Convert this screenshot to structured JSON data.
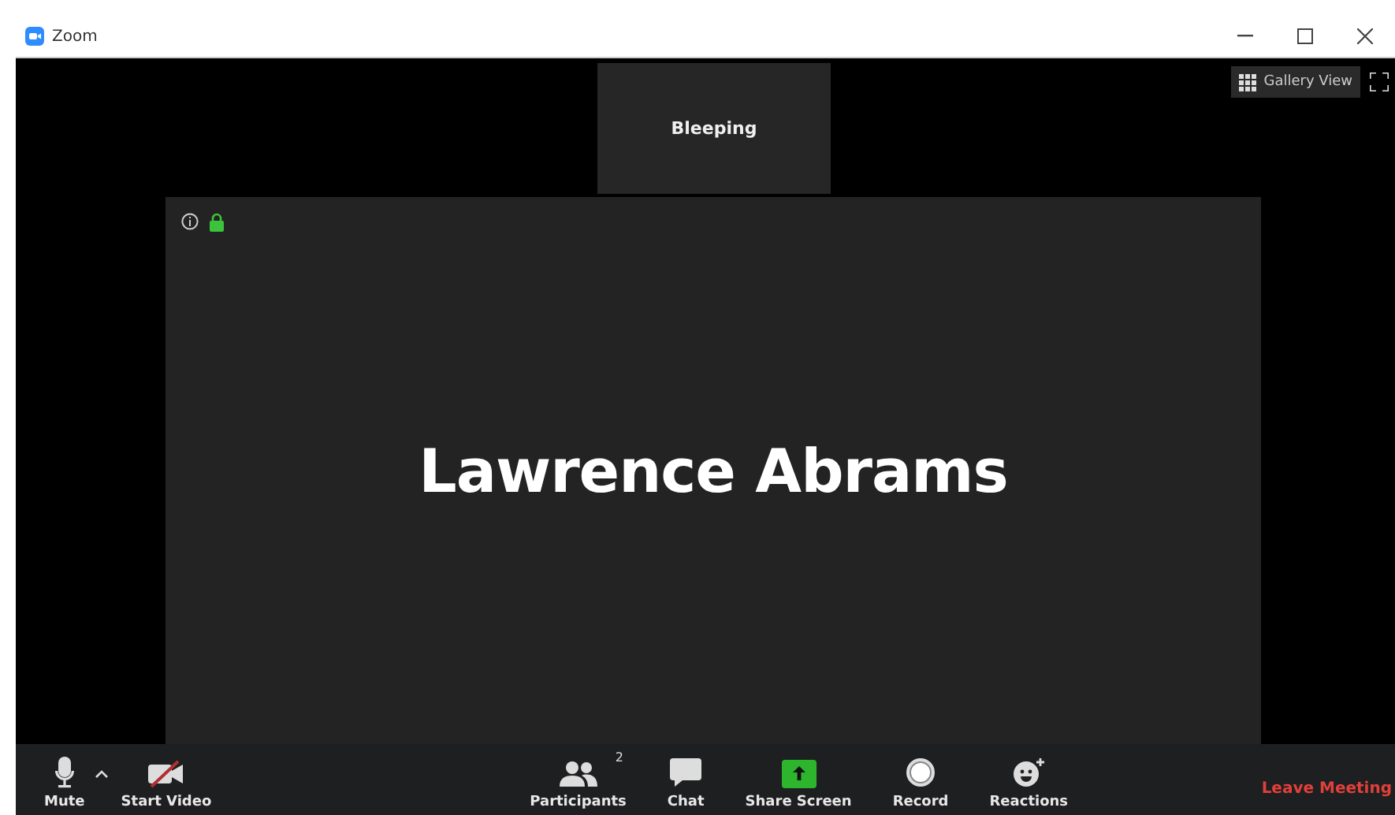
{
  "window": {
    "title": "Zoom"
  },
  "view_button": {
    "label": "Gallery View"
  },
  "thumbnail": {
    "name": "Bleeping"
  },
  "main_video": {
    "name": "Lawrence Abrams"
  },
  "toolbar": {
    "left": [
      {
        "kind": "mute",
        "label": "Mute"
      },
      {
        "kind": "video",
        "label": "Start Video"
      }
    ],
    "center": [
      {
        "kind": "participants",
        "label": "Participants",
        "badge": "2"
      },
      {
        "kind": "chat",
        "label": "Chat"
      },
      {
        "kind": "share",
        "label": "Share Screen"
      },
      {
        "kind": "record",
        "label": "Record"
      },
      {
        "kind": "reactions",
        "label": "Reactions"
      }
    ],
    "leave": "Leave Meeting"
  }
}
